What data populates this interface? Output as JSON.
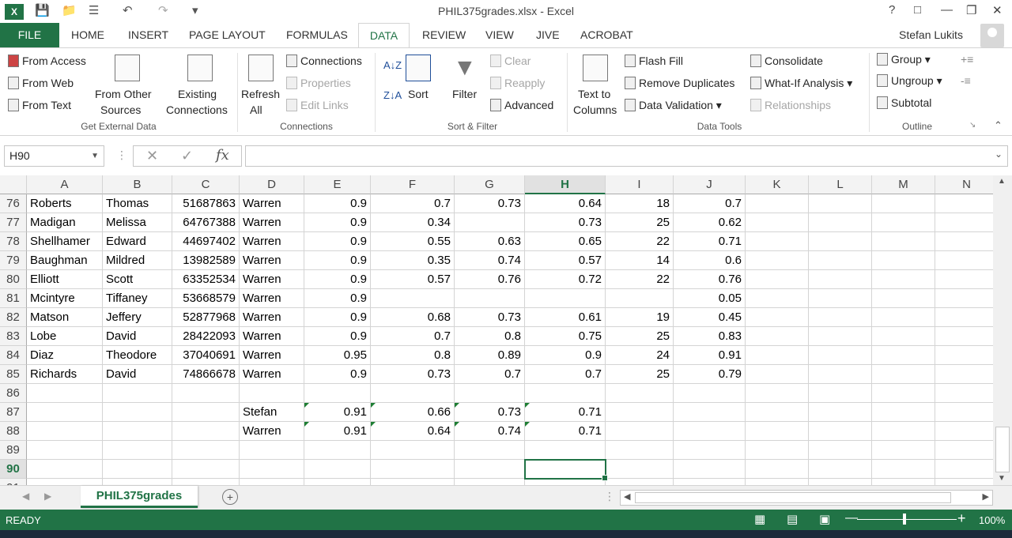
{
  "window": {
    "title": "PHIL375grades.xlsx - Excel",
    "user": "Stefan Lukits"
  },
  "tabs": [
    "FILE",
    "HOME",
    "INSERT",
    "PAGE LAYOUT",
    "FORMULAS",
    "DATA",
    "REVIEW",
    "VIEW",
    "JIVE",
    "ACROBAT"
  ],
  "ribbon": {
    "get_external": {
      "from_access": "From Access",
      "from_web": "From Web",
      "from_text": "From Text",
      "from_other_1": "From Other",
      "from_other_2": "Sources",
      "existing_1": "Existing",
      "existing_2": "Connections",
      "group": "Get External Data"
    },
    "connections": {
      "refresh_1": "Refresh",
      "refresh_2": "All",
      "connections": "Connections",
      "properties": "Properties",
      "edit_links": "Edit Links",
      "group": "Connections"
    },
    "sort_filter": {
      "sort": "Sort",
      "filter": "Filter",
      "clear": "Clear",
      "reapply": "Reapply",
      "advanced": "Advanced",
      "group": "Sort & Filter"
    },
    "data_tools": {
      "text_to_1": "Text to",
      "text_to_2": "Columns",
      "flash_fill": "Flash Fill",
      "remove_dup": "Remove Duplicates",
      "data_validation": "Data Validation",
      "consolidate": "Consolidate",
      "what_if": "What-If Analysis",
      "relationships": "Relationships",
      "group": "Data Tools"
    },
    "outline": {
      "group_btn": "Group",
      "ungroup": "Ungroup",
      "subtotal": "Subtotal",
      "group": "Outline"
    }
  },
  "formula_bar": {
    "name_box": "H90",
    "fx": "fx",
    "content": ""
  },
  "columns": [
    "A",
    "B",
    "C",
    "D",
    "E",
    "F",
    "G",
    "H",
    "I",
    "J",
    "K",
    "L",
    "M",
    "N"
  ],
  "rows": [
    {
      "n": "76",
      "cells": [
        "Roberts",
        "Thomas",
        "51687863",
        "Warren",
        "0.9",
        "0.7",
        "0.73",
        "0.64",
        "18",
        "0.7"
      ]
    },
    {
      "n": "77",
      "cells": [
        "Madigan",
        "Melissa",
        "64767388",
        "Warren",
        "0.9",
        "0.34",
        "",
        "0.73",
        "25",
        "0.62"
      ]
    },
    {
      "n": "78",
      "cells": [
        "Shellhamer",
        "Edward",
        "44697402",
        "Warren",
        "0.9",
        "0.55",
        "0.63",
        "0.65",
        "22",
        "0.71"
      ]
    },
    {
      "n": "79",
      "cells": [
        "Baughman",
        "Mildred",
        "13982589",
        "Warren",
        "0.9",
        "0.35",
        "0.74",
        "0.57",
        "14",
        "0.6"
      ]
    },
    {
      "n": "80",
      "cells": [
        "Elliott",
        "Scott",
        "63352534",
        "Warren",
        "0.9",
        "0.57",
        "0.76",
        "0.72",
        "22",
        "0.76"
      ]
    },
    {
      "n": "81",
      "cells": [
        "Mcintyre",
        "Tiffaney",
        "53668579",
        "Warren",
        "0.9",
        "",
        "",
        "",
        "",
        "0.05"
      ]
    },
    {
      "n": "82",
      "cells": [
        "Matson",
        "Jeffery",
        "52877968",
        "Warren",
        "0.9",
        "0.68",
        "0.73",
        "0.61",
        "19",
        "0.45"
      ]
    },
    {
      "n": "83",
      "cells": [
        "Lobe",
        "David",
        "28422093",
        "Warren",
        "0.9",
        "0.7",
        "0.8",
        "0.75",
        "25",
        "0.83"
      ]
    },
    {
      "n": "84",
      "cells": [
        "Diaz",
        "Theodore",
        "37040691",
        "Warren",
        "0.95",
        "0.8",
        "0.89",
        "0.9",
        "24",
        "0.91"
      ]
    },
    {
      "n": "85",
      "cells": [
        "Richards",
        "David",
        "74866678",
        "Warren",
        "0.9",
        "0.73",
        "0.7",
        "0.7",
        "25",
        "0.79"
      ]
    },
    {
      "n": "86",
      "cells": [
        "",
        "",
        "",
        "",
        "",
        "",
        "",
        "",
        "",
        ""
      ]
    },
    {
      "n": "87",
      "cells": [
        "",
        "",
        "",
        "Stefan",
        "0.91",
        "0.66",
        "0.73",
        "0.71",
        "",
        ""
      ]
    },
    {
      "n": "88",
      "cells": [
        "",
        "",
        "",
        "Warren",
        "0.91",
        "0.64",
        "0.74",
        "0.71",
        "",
        ""
      ]
    },
    {
      "n": "89",
      "cells": [
        "",
        "",
        "",
        "",
        "",
        "",
        "",
        "",
        "",
        ""
      ]
    },
    {
      "n": "90",
      "cells": [
        "",
        "",
        "",
        "",
        "",
        "",
        "",
        "",
        "",
        ""
      ]
    },
    {
      "n": "91",
      "cells": [
        "",
        "",
        "",
        "",
        "",
        "",
        "",
        "",
        "",
        ""
      ]
    }
  ],
  "sheet_tab": "PHIL375grades",
  "status": {
    "ready": "READY",
    "zoom": "100%"
  }
}
